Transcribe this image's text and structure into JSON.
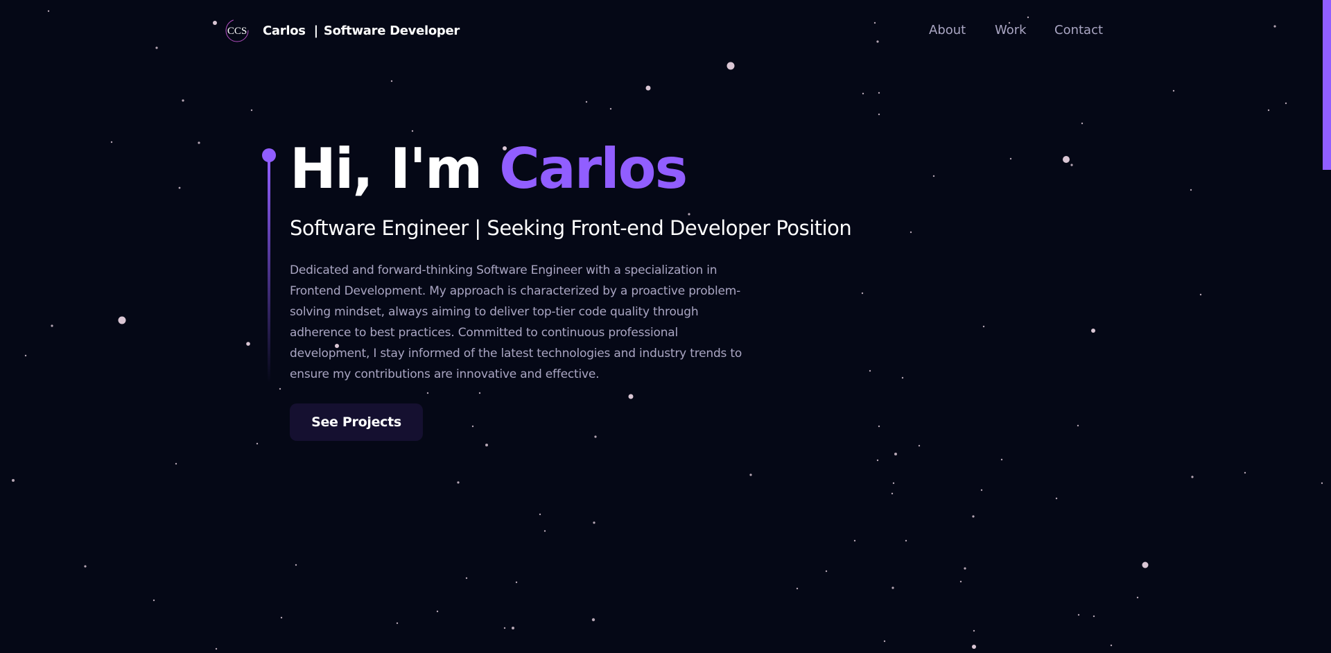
{
  "nav": {
    "logo_text": "CCS",
    "brand_name": "Carlos",
    "brand_separator": "|",
    "brand_role": "Software Developer",
    "links": [
      {
        "label": "About"
      },
      {
        "label": "Work"
      },
      {
        "label": "Contact"
      }
    ]
  },
  "hero": {
    "greeting": "Hi, I'm",
    "name": "Carlos",
    "subtitle": "Software Engineer | Seeking Front-end Developer Position",
    "description": "Dedicated and forward-thinking Software Engineer with a specialization in Frontend Development. My approach is characterized by a proactive problem-solving mindset, always aiming to deliver top-tier code quality through adherence to best practices. Committed to continuous professional development, I stay informed of the latest technologies and industry trends to ensure my contributions are innovative and effective.",
    "cta_label": "See Projects"
  },
  "colors": {
    "background": "#050816",
    "accent": "#915eff",
    "secondary_text": "#aaa6c3",
    "button_bg": "#151030",
    "star": "#f2dbe9"
  }
}
